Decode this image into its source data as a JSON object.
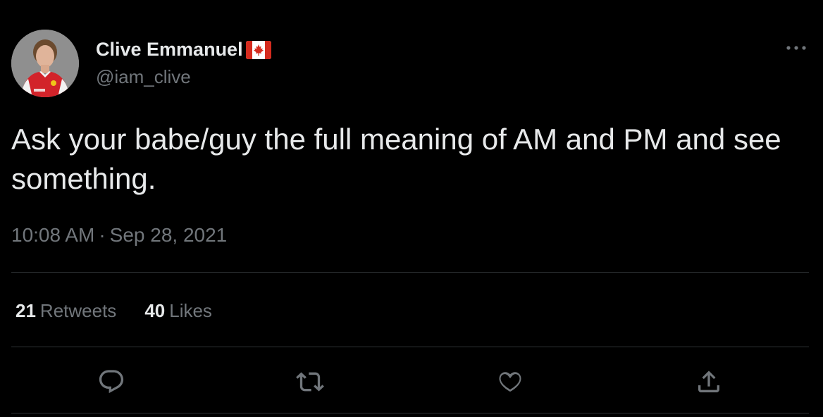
{
  "author": {
    "display_name": "Clive Emmanuel",
    "flag_icon": "canada-flag-icon",
    "handle": "@iam_clive"
  },
  "tweet": {
    "text": "Ask your babe/guy the full meaning of AM and PM and see something.",
    "time": "10:08 AM",
    "separator": "·",
    "date": "Sep 28, 2021"
  },
  "stats": {
    "retweets_count": "21",
    "retweets_label": "Retweets",
    "likes_count": "40",
    "likes_label": "Likes"
  },
  "actions": {
    "reply_icon": "reply-icon",
    "retweet_icon": "retweet-icon",
    "like_icon": "heart-icon",
    "share_icon": "share-icon"
  },
  "colors": {
    "background": "#000000",
    "primary_text": "#e7e9ea",
    "secondary_text": "#71767b",
    "divider": "#2f3336",
    "flag_red": "#d52b1e"
  }
}
